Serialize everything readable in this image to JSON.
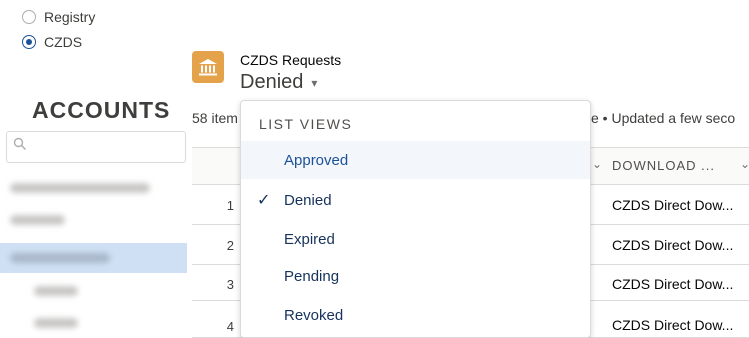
{
  "filters": {
    "radios": [
      {
        "label": "Registry",
        "checked": false
      },
      {
        "label": "CZDS",
        "checked": true
      }
    ]
  },
  "sidebar": {
    "title": "ACCOUNTS",
    "search_placeholder": ""
  },
  "header": {
    "icon": "bank-icon",
    "object_label": "CZDS Requests",
    "view_title": "Denied",
    "caret": "▾"
  },
  "listinfo": {
    "count": "58 item",
    "updated": "e • Updated a few seco"
  },
  "table": {
    "columns": [
      "DOWNLOAD ..."
    ],
    "rows": [
      {
        "num": "1",
        "download": "CZDS Direct Dow..."
      },
      {
        "num": "2",
        "download": "CZDS Direct Dow..."
      },
      {
        "num": "3",
        "download": "CZDS Direct Dow..."
      },
      {
        "num": "4",
        "download": "CZDS Direct Dow..."
      }
    ]
  },
  "list_views": {
    "heading": "LIST VIEWS",
    "items": [
      {
        "label": "Approved",
        "selected": false,
        "highlighted": true
      },
      {
        "label": "Denied",
        "selected": true,
        "highlighted": false
      },
      {
        "label": "Expired",
        "selected": false,
        "highlighted": false
      },
      {
        "label": "Pending",
        "selected": false,
        "highlighted": false
      },
      {
        "label": "Revoked",
        "selected": false,
        "highlighted": false
      }
    ],
    "check_glyph": "✓"
  },
  "colors": {
    "brand_icon": "#e4a24a",
    "selected_row": "#cfe0f4",
    "highlight_item": "#f3f7fb"
  }
}
